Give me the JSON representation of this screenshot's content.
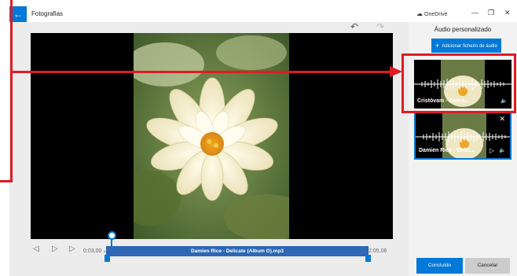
{
  "app": {
    "title": "Fotografias",
    "back_icon": "arrow-left-icon"
  },
  "toolbar": {
    "undo_icon": "undo-icon",
    "redo_icon": "redo-icon"
  },
  "timeline": {
    "start_time": "0:03,00",
    "end_time": "2:05,06",
    "audio_clip_label": "Damien Rice - Delicate (Album O).mp3"
  },
  "panel": {
    "onedrive_label": "OneDrive",
    "title": "Áudio personalizado",
    "add_audio_label": "Adicionar ficheiro de áudio",
    "tracks": [
      {
        "name": "Cristóvam - Andrá...",
        "selected": false
      },
      {
        "name": "Damien Rice - Delic...",
        "selected": true
      }
    ],
    "done_label": "Concluído",
    "cancel_label": "Cancelar"
  },
  "colors": {
    "accent": "#0078d7",
    "annotation": "#e01b24",
    "audio_bar": "#2b67b5"
  }
}
